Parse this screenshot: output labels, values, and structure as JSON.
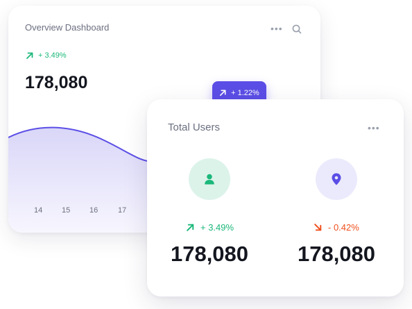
{
  "overview": {
    "title": "Overview Dashboard",
    "more_icon": "more-horizontal-icon",
    "search_icon": "search-icon",
    "trend_icon": "arrow-up-right-icon",
    "trend": "+ 3.49%",
    "value": "178,080",
    "chart_ticks": [
      "14",
      "15",
      "16",
      "17"
    ],
    "line_color": "#5b4ee6"
  },
  "badge": {
    "icon": "arrow-up-right-icon",
    "label": "+ 1.22%",
    "color": "#5b4ee6"
  },
  "total_users": {
    "title": "Total Users",
    "more_icon": "more-horizontal-icon",
    "stats": [
      {
        "icon": "user-icon",
        "trend_icon": "arrow-up-right-icon",
        "trend": "+ 3.49%",
        "value": "178,080",
        "color": "#1bb87a"
      },
      {
        "icon": "location-pin-icon",
        "trend_icon": "arrow-down-right-icon",
        "trend": "- 0.42%",
        "value": "178,080",
        "color": "#f04f1d"
      }
    ]
  }
}
